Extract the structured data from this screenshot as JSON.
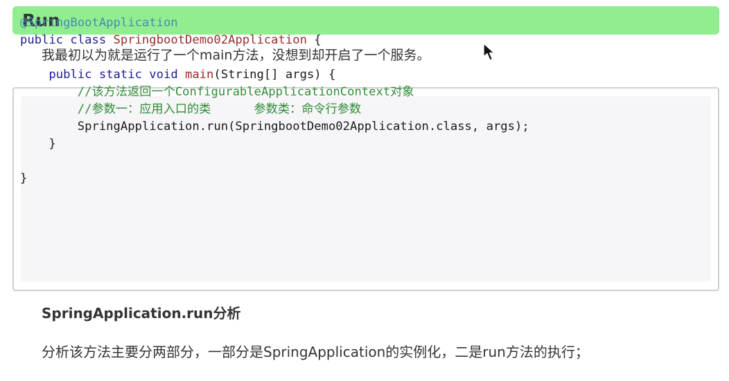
{
  "heading": {
    "title": "Run"
  },
  "intro": {
    "text": "我最初以为就是运行了一个main方法，没想到却开启了一个服务。"
  },
  "code": {
    "line1_annotation": "@SpringBootApplication",
    "line2_kw": "public class ",
    "line2_class": "SpringbootDemo02Application",
    "line2_rest": " {",
    "line4_indent": "    ",
    "line4_kw": "public static void ",
    "line4_fn": "main",
    "line4_rest": "(String[] args) {",
    "line5_comment": "        //该方法返回一个ConfigurableApplicationContext对象",
    "line6_comment": "        //参数一：应用入口的类      参数类：命令行参数",
    "line7_code": "        SpringApplication.run(SpringbootDemo02Application.class, args);",
    "line8_code": "    }",
    "line10_code": "}"
  },
  "section": {
    "title": "SpringApplication.run分析"
  },
  "summary": {
    "text": "分析该方法主要分两部分，一部分是SpringApplication的实例化，二是run方法的执行；"
  }
}
